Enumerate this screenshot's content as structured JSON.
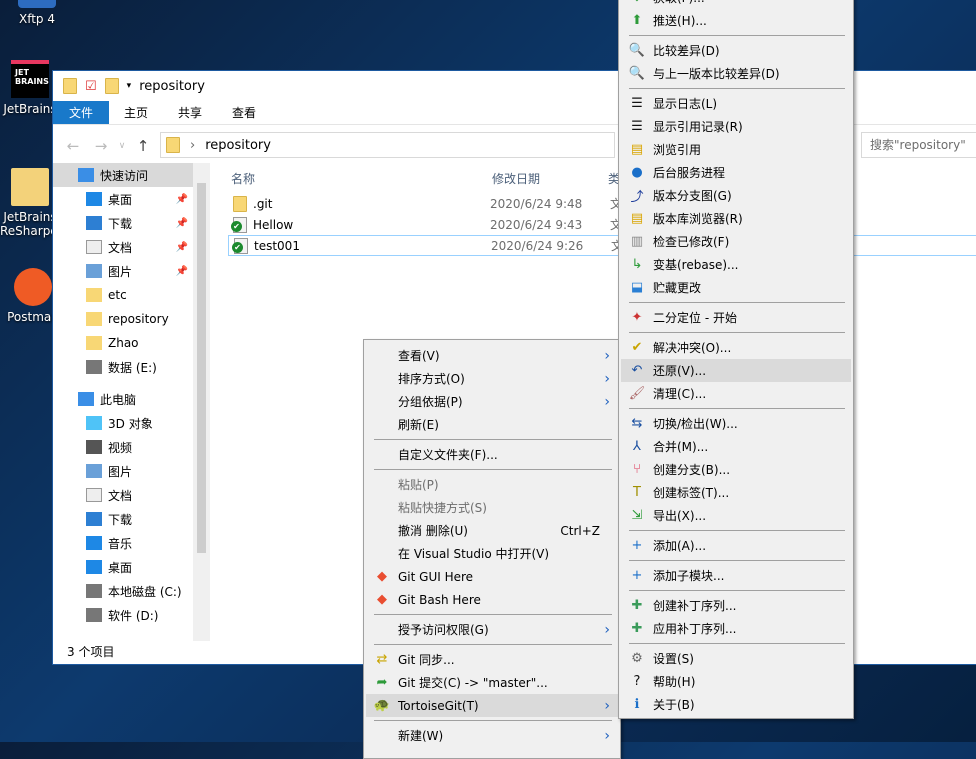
{
  "desktop": {
    "icons": [
      {
        "label": "Xftp 4"
      },
      {
        "label": "JetBrains"
      },
      {
        "label": "JetBrains ReSharper"
      },
      {
        "label": "Postman"
      }
    ]
  },
  "explorer": {
    "title": "repository",
    "ribbon_tabs": [
      "文件",
      "主页",
      "共享",
      "查看"
    ],
    "address": "repository",
    "search_placeholder": "搜索\"repository\"",
    "nav": [
      {
        "label": "快速访问",
        "pinned": false
      },
      {
        "label": "桌面",
        "pinned": true
      },
      {
        "label": "下载",
        "pinned": true
      },
      {
        "label": "文档",
        "pinned": true
      },
      {
        "label": "图片",
        "pinned": true
      },
      {
        "label": "etc",
        "pinned": false
      },
      {
        "label": "repository",
        "pinned": false
      },
      {
        "label": "Zhao",
        "pinned": false
      },
      {
        "label": "数据 (E:)",
        "pinned": false
      },
      {
        "label": "此电脑",
        "pinned": false
      },
      {
        "label": "3D 对象",
        "pinned": false
      },
      {
        "label": "视频",
        "pinned": false
      },
      {
        "label": "图片",
        "pinned": false
      },
      {
        "label": "文档",
        "pinned": false
      },
      {
        "label": "下载",
        "pinned": false
      },
      {
        "label": "音乐",
        "pinned": false
      },
      {
        "label": "桌面",
        "pinned": false
      },
      {
        "label": "本地磁盘 (C:)",
        "pinned": false
      },
      {
        "label": "软件 (D:)",
        "pinned": false
      }
    ],
    "columns": [
      "名称",
      "修改日期",
      "类"
    ],
    "files": [
      {
        "name": ".git",
        "date": "2020/6/24 9:48",
        "type": "文"
      },
      {
        "name": "Hellow",
        "date": "2020/6/24 9:43",
        "type": "文"
      },
      {
        "name": "test001",
        "date": "2020/6/24 9:26",
        "type": "文"
      }
    ],
    "status": "3 个项目"
  },
  "context_menu": {
    "items": [
      {
        "label": "查看(V)",
        "submenu": true
      },
      {
        "label": "排序方式(O)",
        "submenu": true
      },
      {
        "label": "分组依据(P)",
        "submenu": true
      },
      {
        "label": "刷新(E)"
      },
      {
        "sep": true
      },
      {
        "label": "自定义文件夹(F)..."
      },
      {
        "sep": true
      },
      {
        "label": "粘贴(P)",
        "disabled": true
      },
      {
        "label": "粘贴快捷方式(S)",
        "disabled": true
      },
      {
        "label": "撤消 删除(U)",
        "shortcut": "Ctrl+Z"
      },
      {
        "label": "在 Visual Studio 中打开(V)"
      },
      {
        "label": "Git GUI Here",
        "icon": "git-icon"
      },
      {
        "label": "Git Bash Here",
        "icon": "git-icon"
      },
      {
        "sep": true
      },
      {
        "label": "授予访问权限(G)",
        "submenu": true
      },
      {
        "sep": true
      },
      {
        "label": "Git 同步...",
        "icon": "sync-icon"
      },
      {
        "label": "Git 提交(C) -> \"master\"...",
        "icon": "commit-icon"
      },
      {
        "label": "TortoiseGit(T)",
        "icon": "tortoise-icon",
        "submenu": true,
        "highlighted": true
      },
      {
        "sep": true
      },
      {
        "label": "新建(W)",
        "submenu": true
      }
    ]
  },
  "tortoise_menu": {
    "items": [
      {
        "label": "获取(F)...",
        "icon": "fetch-icon"
      },
      {
        "label": "推送(H)...",
        "icon": "push-icon"
      },
      {
        "sep": true
      },
      {
        "label": "比较差异(D)",
        "icon": "diff-icon"
      },
      {
        "label": "与上一版本比较差异(D)",
        "icon": "diff-icon"
      },
      {
        "sep": true
      },
      {
        "label": "显示日志(L)",
        "icon": "log-icon"
      },
      {
        "label": "显示引用记录(R)",
        "icon": "log-icon"
      },
      {
        "label": "浏览引用",
        "icon": "browse-icon"
      },
      {
        "label": "后台服务进程",
        "icon": "globe-icon"
      },
      {
        "label": "版本分支图(G)",
        "icon": "graph-icon"
      },
      {
        "label": "版本库浏览器(R)",
        "icon": "browse-icon"
      },
      {
        "label": "检查已修改(F)",
        "icon": "check-icon"
      },
      {
        "label": "变基(rebase)...",
        "icon": "rebase-icon"
      },
      {
        "label": "贮藏更改",
        "icon": "stash-icon"
      },
      {
        "sep": true
      },
      {
        "label": "二分定位 - 开始",
        "icon": "bisect-icon"
      },
      {
        "sep": true
      },
      {
        "label": "解决冲突(O)...",
        "icon": "resolve-icon"
      },
      {
        "label": "还原(V)...",
        "icon": "revert-icon",
        "highlighted": true
      },
      {
        "label": "清理(C)...",
        "icon": "cleanup-icon"
      },
      {
        "sep": true
      },
      {
        "label": "切换/检出(W)...",
        "icon": "switch-icon"
      },
      {
        "label": "合并(M)...",
        "icon": "merge-icon"
      },
      {
        "label": "创建分支(B)...",
        "icon": "branch-icon"
      },
      {
        "label": "创建标签(T)...",
        "icon": "tag-icon"
      },
      {
        "label": "导出(X)...",
        "icon": "export-icon"
      },
      {
        "sep": true
      },
      {
        "label": "添加(A)...",
        "icon": "add-icon"
      },
      {
        "sep": true
      },
      {
        "label": "添加子模块...",
        "icon": "add-icon"
      },
      {
        "sep": true
      },
      {
        "label": "创建补丁序列...",
        "icon": "patch-icon"
      },
      {
        "label": "应用补丁序列...",
        "icon": "patch-icon"
      },
      {
        "sep": true
      },
      {
        "label": "设置(S)",
        "icon": "settings-icon"
      },
      {
        "label": "帮助(H)",
        "icon": "help-icon"
      },
      {
        "label": "关于(B)",
        "icon": "info-icon"
      }
    ]
  },
  "colors": {
    "ribbon_active": "#1979ca",
    "menu_bg": "#f0f0f0",
    "menu_highlight": "#dadada",
    "selection_border": "#99d1ff"
  }
}
